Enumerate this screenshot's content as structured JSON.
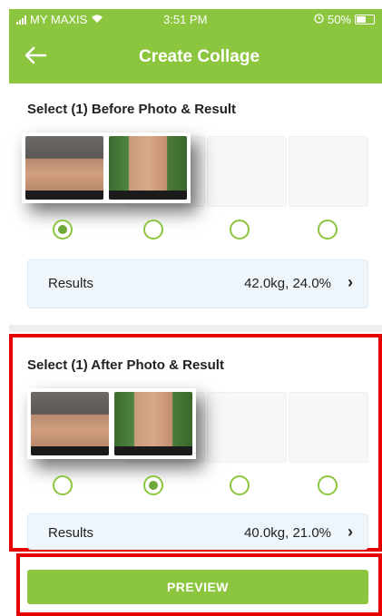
{
  "status": {
    "carrier": "MY MAXIS",
    "time": "3:51 PM",
    "battery": "50%"
  },
  "nav": {
    "title": "Create Collage",
    "back_icon": "back-arrow-icon"
  },
  "before": {
    "title": "Select (1) Before Photo & Result",
    "selected_index": 0,
    "results_label": "Results",
    "results_value": "42.0kg, 24.0%"
  },
  "after": {
    "title": "Select (1) After Photo & Result",
    "selected_index": 1,
    "results_label": "Results",
    "results_value": "40.0kg, 21.0%"
  },
  "preview": {
    "label": "PREVIEW"
  },
  "colors": {
    "brand_green": "#8cc63f",
    "highlight_red": "#e60000"
  }
}
